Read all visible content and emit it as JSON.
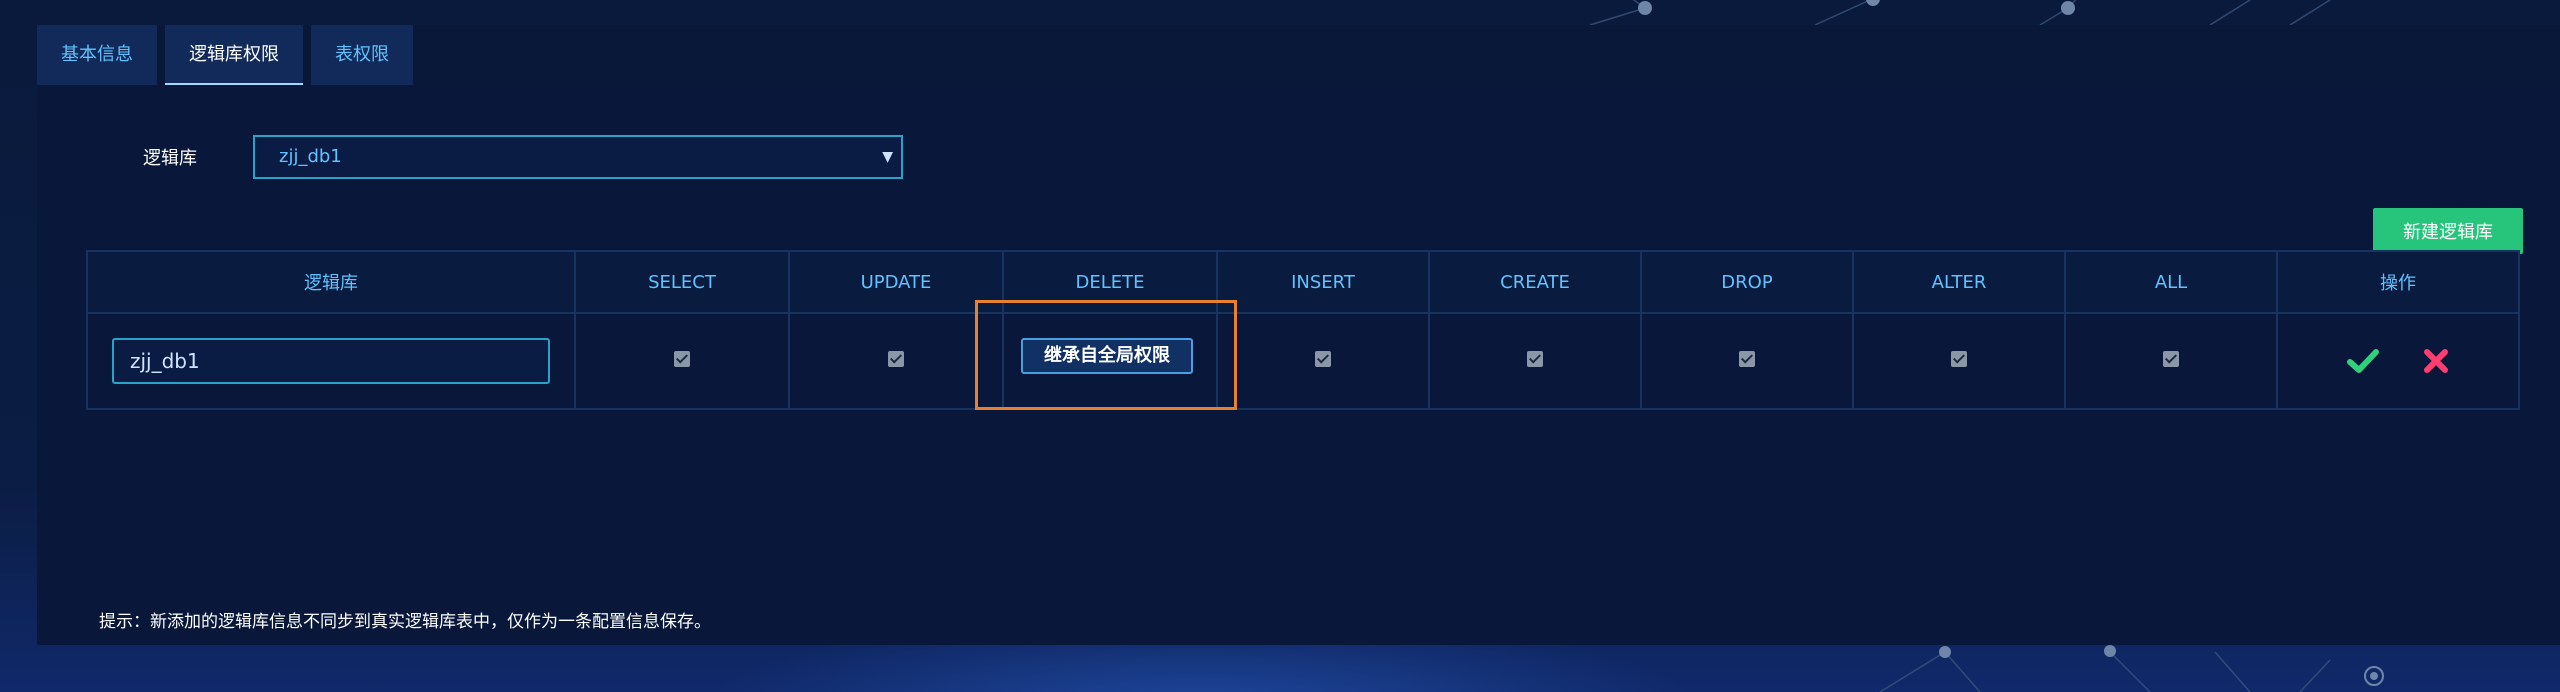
{
  "tabs": [
    {
      "label": "基本信息"
    },
    {
      "label": "逻辑库权限"
    },
    {
      "label": "表权限"
    }
  ],
  "form": {
    "label": "逻辑库",
    "selected_value": "zjj_db1"
  },
  "new_button_label": "新建逻辑库",
  "table": {
    "headers": [
      "逻辑库",
      "SELECT",
      "UPDATE",
      "DELETE",
      "INSERT",
      "CREATE",
      "DROP",
      "ALTER",
      "ALL",
      "操作"
    ],
    "row": {
      "input_value": "zjj_db1",
      "checkboxes": [
        true,
        true,
        true,
        true,
        true,
        true,
        true,
        true
      ]
    }
  },
  "tooltip": "继承自全局权限",
  "hint": "提示：新添加的逻辑库信息不同步到真实逻辑库表中，仅作为一条配置信息保存。",
  "icons": {
    "confirm": "check-icon",
    "cancel": "close-icon"
  },
  "colors": {
    "accent": "#5fc3ff",
    "add_button": "#27c47c",
    "confirm": "#2fd27a",
    "cancel": "#ff3d6e",
    "highlight": "#e8812f"
  }
}
